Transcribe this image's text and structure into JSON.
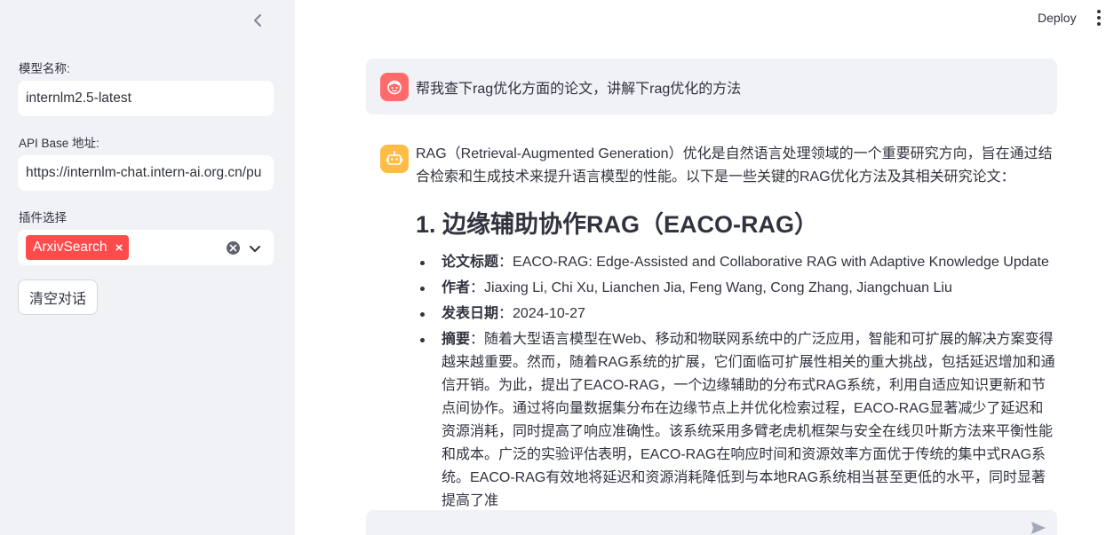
{
  "sidebar": {
    "model_label": "模型名称:",
    "model_value": "internlm2.5-latest",
    "api_label": "API Base 地址:",
    "api_value": "https://internlm-chat.intern-ai.org.cn/pu",
    "plugin_label": "插件选择",
    "plugin_tags": [
      "ArxivSearch"
    ],
    "clear_button": "清空对话"
  },
  "header": {
    "deploy_label": "Deploy"
  },
  "chat": {
    "user_message": "帮我查下rag优化方面的论文，讲解下rag优化的方法",
    "assistant": {
      "intro": "RAG（Retrieval-Augmented Generation）优化是自然语言处理领域的一个重要研究方向，旨在通过结合检索和生成技术来提升语言模型的性能。以下是一些关键的RAG优化方法及其相关研究论文：",
      "section_title": "1. 边缘辅助协作RAG（EACO-RAG）",
      "fields": [
        {
          "key": "论文标题",
          "value": "：EACO-RAG: Edge-Assisted and Collaborative RAG with Adaptive Knowledge Update"
        },
        {
          "key": "作者",
          "value": "：Jiaxing Li, Chi Xu, Lianchen Jia, Feng Wang, Cong Zhang, Jiangchuan Liu"
        },
        {
          "key": "发表日期",
          "value": "：2024-10-27"
        },
        {
          "key": "摘要",
          "value": "：随着大型语言模型在Web、移动和物联网系统中的广泛应用，智能和可扩展的解决方案变得越来越重要。然而，随着RAG系统的扩展，它们面临可扩展性相关的重大挑战，包括延迟增加和通信开销。为此，提出了EACO-RAG，一个边缘辅助的分布式RAG系统，利用自适应知识更新和节点间协作。通过将向量数据集分布在边缘节点上并优化检索过程，EACO-RAG显著减少了延迟和资源消耗，同时提高了响应准确性。该系统采用多臂老虎机框架与安全在线贝叶斯方法来平衡性能和成本。广泛的实验评估表明，EACO-RAG在响应时间和资源效率方面优于传统的集中式RAG系统。EACO-RAG有效地将延迟和资源消耗降低到与本地RAG系统相当甚至更低的水平，同时显著提高了准"
        }
      ]
    }
  },
  "colors": {
    "sidebar_bg": "#f0f2f6",
    "accent": "#ff4b4b",
    "user_avatar": "#ff6b6b",
    "assistant_avatar": "#ffbd45"
  }
}
